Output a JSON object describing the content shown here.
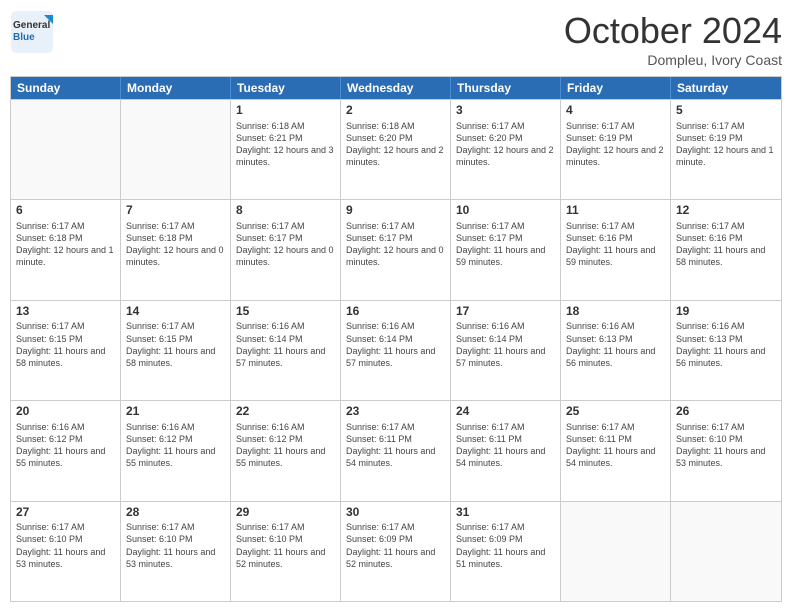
{
  "logo": {
    "line1": "General",
    "line2": "Blue"
  },
  "header": {
    "month": "October 2024",
    "location": "Dompleu, Ivory Coast"
  },
  "days": [
    "Sunday",
    "Monday",
    "Tuesday",
    "Wednesday",
    "Thursday",
    "Friday",
    "Saturday"
  ],
  "weeks": [
    [
      {
        "day": "",
        "empty": true
      },
      {
        "day": "",
        "empty": true
      },
      {
        "day": "1",
        "sunrise": "Sunrise: 6:18 AM",
        "sunset": "Sunset: 6:21 PM",
        "daylight": "Daylight: 12 hours and 3 minutes."
      },
      {
        "day": "2",
        "sunrise": "Sunrise: 6:18 AM",
        "sunset": "Sunset: 6:20 PM",
        "daylight": "Daylight: 12 hours and 2 minutes."
      },
      {
        "day": "3",
        "sunrise": "Sunrise: 6:17 AM",
        "sunset": "Sunset: 6:20 PM",
        "daylight": "Daylight: 12 hours and 2 minutes."
      },
      {
        "day": "4",
        "sunrise": "Sunrise: 6:17 AM",
        "sunset": "Sunset: 6:19 PM",
        "daylight": "Daylight: 12 hours and 2 minutes."
      },
      {
        "day": "5",
        "sunrise": "Sunrise: 6:17 AM",
        "sunset": "Sunset: 6:19 PM",
        "daylight": "Daylight: 12 hours and 1 minute."
      }
    ],
    [
      {
        "day": "6",
        "sunrise": "Sunrise: 6:17 AM",
        "sunset": "Sunset: 6:18 PM",
        "daylight": "Daylight: 12 hours and 1 minute."
      },
      {
        "day": "7",
        "sunrise": "Sunrise: 6:17 AM",
        "sunset": "Sunset: 6:18 PM",
        "daylight": "Daylight: 12 hours and 0 minutes."
      },
      {
        "day": "8",
        "sunrise": "Sunrise: 6:17 AM",
        "sunset": "Sunset: 6:17 PM",
        "daylight": "Daylight: 12 hours and 0 minutes."
      },
      {
        "day": "9",
        "sunrise": "Sunrise: 6:17 AM",
        "sunset": "Sunset: 6:17 PM",
        "daylight": "Daylight: 12 hours and 0 minutes."
      },
      {
        "day": "10",
        "sunrise": "Sunrise: 6:17 AM",
        "sunset": "Sunset: 6:17 PM",
        "daylight": "Daylight: 11 hours and 59 minutes."
      },
      {
        "day": "11",
        "sunrise": "Sunrise: 6:17 AM",
        "sunset": "Sunset: 6:16 PM",
        "daylight": "Daylight: 11 hours and 59 minutes."
      },
      {
        "day": "12",
        "sunrise": "Sunrise: 6:17 AM",
        "sunset": "Sunset: 6:16 PM",
        "daylight": "Daylight: 11 hours and 58 minutes."
      }
    ],
    [
      {
        "day": "13",
        "sunrise": "Sunrise: 6:17 AM",
        "sunset": "Sunset: 6:15 PM",
        "daylight": "Daylight: 11 hours and 58 minutes."
      },
      {
        "day": "14",
        "sunrise": "Sunrise: 6:17 AM",
        "sunset": "Sunset: 6:15 PM",
        "daylight": "Daylight: 11 hours and 58 minutes."
      },
      {
        "day": "15",
        "sunrise": "Sunrise: 6:16 AM",
        "sunset": "Sunset: 6:14 PM",
        "daylight": "Daylight: 11 hours and 57 minutes."
      },
      {
        "day": "16",
        "sunrise": "Sunrise: 6:16 AM",
        "sunset": "Sunset: 6:14 PM",
        "daylight": "Daylight: 11 hours and 57 minutes."
      },
      {
        "day": "17",
        "sunrise": "Sunrise: 6:16 AM",
        "sunset": "Sunset: 6:14 PM",
        "daylight": "Daylight: 11 hours and 57 minutes."
      },
      {
        "day": "18",
        "sunrise": "Sunrise: 6:16 AM",
        "sunset": "Sunset: 6:13 PM",
        "daylight": "Daylight: 11 hours and 56 minutes."
      },
      {
        "day": "19",
        "sunrise": "Sunrise: 6:16 AM",
        "sunset": "Sunset: 6:13 PM",
        "daylight": "Daylight: 11 hours and 56 minutes."
      }
    ],
    [
      {
        "day": "20",
        "sunrise": "Sunrise: 6:16 AM",
        "sunset": "Sunset: 6:12 PM",
        "daylight": "Daylight: 11 hours and 55 minutes."
      },
      {
        "day": "21",
        "sunrise": "Sunrise: 6:16 AM",
        "sunset": "Sunset: 6:12 PM",
        "daylight": "Daylight: 11 hours and 55 minutes."
      },
      {
        "day": "22",
        "sunrise": "Sunrise: 6:16 AM",
        "sunset": "Sunset: 6:12 PM",
        "daylight": "Daylight: 11 hours and 55 minutes."
      },
      {
        "day": "23",
        "sunrise": "Sunrise: 6:17 AM",
        "sunset": "Sunset: 6:11 PM",
        "daylight": "Daylight: 11 hours and 54 minutes."
      },
      {
        "day": "24",
        "sunrise": "Sunrise: 6:17 AM",
        "sunset": "Sunset: 6:11 PM",
        "daylight": "Daylight: 11 hours and 54 minutes."
      },
      {
        "day": "25",
        "sunrise": "Sunrise: 6:17 AM",
        "sunset": "Sunset: 6:11 PM",
        "daylight": "Daylight: 11 hours and 54 minutes."
      },
      {
        "day": "26",
        "sunrise": "Sunrise: 6:17 AM",
        "sunset": "Sunset: 6:10 PM",
        "daylight": "Daylight: 11 hours and 53 minutes."
      }
    ],
    [
      {
        "day": "27",
        "sunrise": "Sunrise: 6:17 AM",
        "sunset": "Sunset: 6:10 PM",
        "daylight": "Daylight: 11 hours and 53 minutes."
      },
      {
        "day": "28",
        "sunrise": "Sunrise: 6:17 AM",
        "sunset": "Sunset: 6:10 PM",
        "daylight": "Daylight: 11 hours and 53 minutes."
      },
      {
        "day": "29",
        "sunrise": "Sunrise: 6:17 AM",
        "sunset": "Sunset: 6:10 PM",
        "daylight": "Daylight: 11 hours and 52 minutes."
      },
      {
        "day": "30",
        "sunrise": "Sunrise: 6:17 AM",
        "sunset": "Sunset: 6:09 PM",
        "daylight": "Daylight: 11 hours and 52 minutes."
      },
      {
        "day": "31",
        "sunrise": "Sunrise: 6:17 AM",
        "sunset": "Sunset: 6:09 PM",
        "daylight": "Daylight: 11 hours and 51 minutes."
      },
      {
        "day": "",
        "empty": true
      },
      {
        "day": "",
        "empty": true
      }
    ]
  ]
}
